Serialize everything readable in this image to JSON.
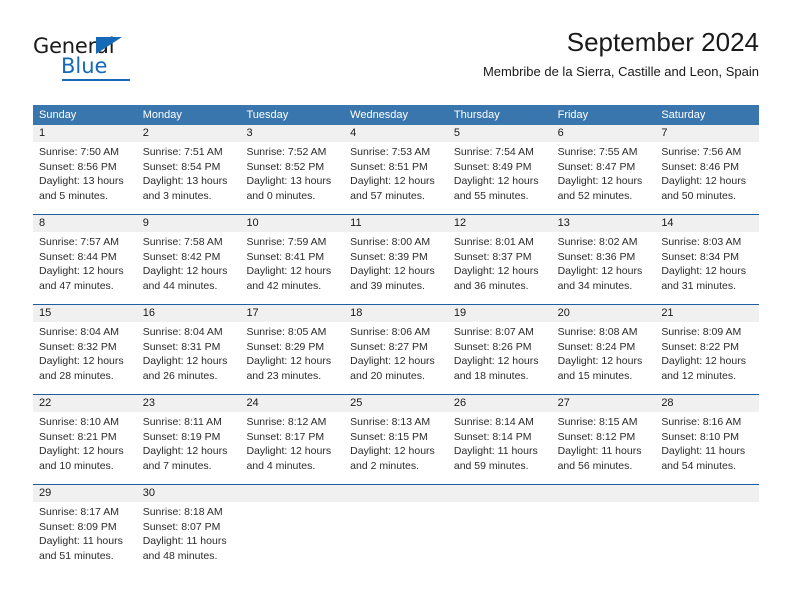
{
  "logo": {
    "word_top": "General",
    "word_bottom": "Blue",
    "triangle_icon": "triangle-icon",
    "brand_color": "#1669b7"
  },
  "header": {
    "title": "September 2024",
    "subtitle": "Membribe de la Sierra, Castille and Leon, Spain"
  },
  "theme": {
    "header_blue": "#3a76ae",
    "separator_blue": "#1f5fa0",
    "daynum_band": "#f0f0f0",
    "cell_background": "#ffffff"
  },
  "weekdays": [
    "Sunday",
    "Monday",
    "Tuesday",
    "Wednesday",
    "Thursday",
    "Friday",
    "Saturday"
  ],
  "weeks": [
    {
      "daynums": [
        "1",
        "2",
        "3",
        "4",
        "5",
        "6",
        "7"
      ],
      "cells": [
        {
          "sunrise": "Sunrise: 7:50 AM",
          "sunset": "Sunset: 8:56 PM",
          "daylight1": "Daylight: 13 hours",
          "daylight2": "and 5 minutes."
        },
        {
          "sunrise": "Sunrise: 7:51 AM",
          "sunset": "Sunset: 8:54 PM",
          "daylight1": "Daylight: 13 hours",
          "daylight2": "and 3 minutes."
        },
        {
          "sunrise": "Sunrise: 7:52 AM",
          "sunset": "Sunset: 8:52 PM",
          "daylight1": "Daylight: 13 hours",
          "daylight2": "and 0 minutes."
        },
        {
          "sunrise": "Sunrise: 7:53 AM",
          "sunset": "Sunset: 8:51 PM",
          "daylight1": "Daylight: 12 hours",
          "daylight2": "and 57 minutes."
        },
        {
          "sunrise": "Sunrise: 7:54 AM",
          "sunset": "Sunset: 8:49 PM",
          "daylight1": "Daylight: 12 hours",
          "daylight2": "and 55 minutes."
        },
        {
          "sunrise": "Sunrise: 7:55 AM",
          "sunset": "Sunset: 8:47 PM",
          "daylight1": "Daylight: 12 hours",
          "daylight2": "and 52 minutes."
        },
        {
          "sunrise": "Sunrise: 7:56 AM",
          "sunset": "Sunset: 8:46 PM",
          "daylight1": "Daylight: 12 hours",
          "daylight2": "and 50 minutes."
        }
      ]
    },
    {
      "daynums": [
        "8",
        "9",
        "10",
        "11",
        "12",
        "13",
        "14"
      ],
      "cells": [
        {
          "sunrise": "Sunrise: 7:57 AM",
          "sunset": "Sunset: 8:44 PM",
          "daylight1": "Daylight: 12 hours",
          "daylight2": "and 47 minutes."
        },
        {
          "sunrise": "Sunrise: 7:58 AM",
          "sunset": "Sunset: 8:42 PM",
          "daylight1": "Daylight: 12 hours",
          "daylight2": "and 44 minutes."
        },
        {
          "sunrise": "Sunrise: 7:59 AM",
          "sunset": "Sunset: 8:41 PM",
          "daylight1": "Daylight: 12 hours",
          "daylight2": "and 42 minutes."
        },
        {
          "sunrise": "Sunrise: 8:00 AM",
          "sunset": "Sunset: 8:39 PM",
          "daylight1": "Daylight: 12 hours",
          "daylight2": "and 39 minutes."
        },
        {
          "sunrise": "Sunrise: 8:01 AM",
          "sunset": "Sunset: 8:37 PM",
          "daylight1": "Daylight: 12 hours",
          "daylight2": "and 36 minutes."
        },
        {
          "sunrise": "Sunrise: 8:02 AM",
          "sunset": "Sunset: 8:36 PM",
          "daylight1": "Daylight: 12 hours",
          "daylight2": "and 34 minutes."
        },
        {
          "sunrise": "Sunrise: 8:03 AM",
          "sunset": "Sunset: 8:34 PM",
          "daylight1": "Daylight: 12 hours",
          "daylight2": "and 31 minutes."
        }
      ]
    },
    {
      "daynums": [
        "15",
        "16",
        "17",
        "18",
        "19",
        "20",
        "21"
      ],
      "cells": [
        {
          "sunrise": "Sunrise: 8:04 AM",
          "sunset": "Sunset: 8:32 PM",
          "daylight1": "Daylight: 12 hours",
          "daylight2": "and 28 minutes."
        },
        {
          "sunrise": "Sunrise: 8:04 AM",
          "sunset": "Sunset: 8:31 PM",
          "daylight1": "Daylight: 12 hours",
          "daylight2": "and 26 minutes."
        },
        {
          "sunrise": "Sunrise: 8:05 AM",
          "sunset": "Sunset: 8:29 PM",
          "daylight1": "Daylight: 12 hours",
          "daylight2": "and 23 minutes."
        },
        {
          "sunrise": "Sunrise: 8:06 AM",
          "sunset": "Sunset: 8:27 PM",
          "daylight1": "Daylight: 12 hours",
          "daylight2": "and 20 minutes."
        },
        {
          "sunrise": "Sunrise: 8:07 AM",
          "sunset": "Sunset: 8:26 PM",
          "daylight1": "Daylight: 12 hours",
          "daylight2": "and 18 minutes."
        },
        {
          "sunrise": "Sunrise: 8:08 AM",
          "sunset": "Sunset: 8:24 PM",
          "daylight1": "Daylight: 12 hours",
          "daylight2": "and 15 minutes."
        },
        {
          "sunrise": "Sunrise: 8:09 AM",
          "sunset": "Sunset: 8:22 PM",
          "daylight1": "Daylight: 12 hours",
          "daylight2": "and 12 minutes."
        }
      ]
    },
    {
      "daynums": [
        "22",
        "23",
        "24",
        "25",
        "26",
        "27",
        "28"
      ],
      "cells": [
        {
          "sunrise": "Sunrise: 8:10 AM",
          "sunset": "Sunset: 8:21 PM",
          "daylight1": "Daylight: 12 hours",
          "daylight2": "and 10 minutes."
        },
        {
          "sunrise": "Sunrise: 8:11 AM",
          "sunset": "Sunset: 8:19 PM",
          "daylight1": "Daylight: 12 hours",
          "daylight2": "and 7 minutes."
        },
        {
          "sunrise": "Sunrise: 8:12 AM",
          "sunset": "Sunset: 8:17 PM",
          "daylight1": "Daylight: 12 hours",
          "daylight2": "and 4 minutes."
        },
        {
          "sunrise": "Sunrise: 8:13 AM",
          "sunset": "Sunset: 8:15 PM",
          "daylight1": "Daylight: 12 hours",
          "daylight2": "and 2 minutes."
        },
        {
          "sunrise": "Sunrise: 8:14 AM",
          "sunset": "Sunset: 8:14 PM",
          "daylight1": "Daylight: 11 hours",
          "daylight2": "and 59 minutes."
        },
        {
          "sunrise": "Sunrise: 8:15 AM",
          "sunset": "Sunset: 8:12 PM",
          "daylight1": "Daylight: 11 hours",
          "daylight2": "and 56 minutes."
        },
        {
          "sunrise": "Sunrise: 8:16 AM",
          "sunset": "Sunset: 8:10 PM",
          "daylight1": "Daylight: 11 hours",
          "daylight2": "and 54 minutes."
        }
      ]
    },
    {
      "daynums": [
        "29",
        "30",
        "",
        "",
        "",
        "",
        ""
      ],
      "cells": [
        {
          "sunrise": "Sunrise: 8:17 AM",
          "sunset": "Sunset: 8:09 PM",
          "daylight1": "Daylight: 11 hours",
          "daylight2": "and 51 minutes."
        },
        {
          "sunrise": "Sunrise: 8:18 AM",
          "sunset": "Sunset: 8:07 PM",
          "daylight1": "Daylight: 11 hours",
          "daylight2": "and 48 minutes."
        },
        {
          "sunrise": "",
          "sunset": "",
          "daylight1": "",
          "daylight2": ""
        },
        {
          "sunrise": "",
          "sunset": "",
          "daylight1": "",
          "daylight2": ""
        },
        {
          "sunrise": "",
          "sunset": "",
          "daylight1": "",
          "daylight2": ""
        },
        {
          "sunrise": "",
          "sunset": "",
          "daylight1": "",
          "daylight2": ""
        },
        {
          "sunrise": "",
          "sunset": "",
          "daylight1": "",
          "daylight2": ""
        }
      ]
    }
  ]
}
